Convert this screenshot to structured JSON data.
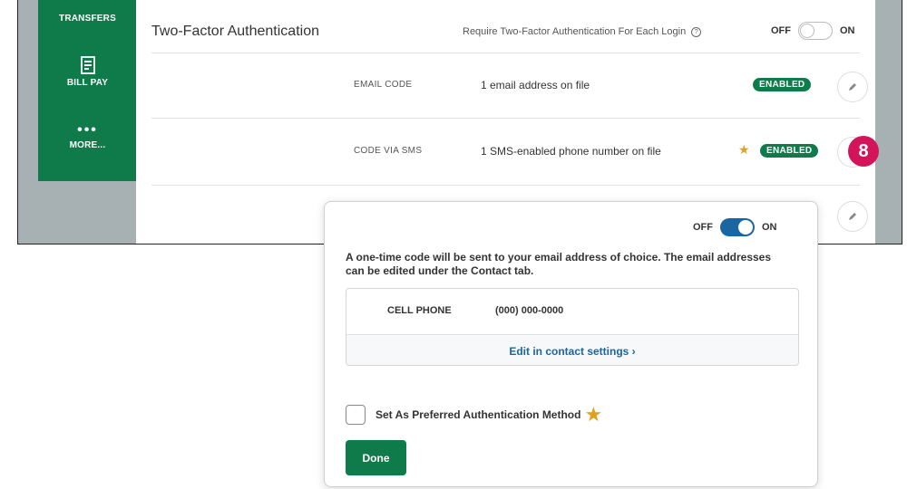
{
  "sidebar": {
    "items": [
      {
        "label": "TRANSFERS",
        "icon": "transfer-icon"
      },
      {
        "label": "BILL PAY",
        "icon": "bill-pay-icon"
      },
      {
        "label": "MORE...",
        "icon": "more-dots-icon",
        "glyph": "•••"
      }
    ]
  },
  "section": {
    "title": "Two-Factor Authentication",
    "requirement_text": "Require Two-Factor Authentication For Each Login",
    "toggle": {
      "off_label": "OFF",
      "on_label": "ON",
      "state": "off"
    }
  },
  "methods": [
    {
      "name": "EMAIL CODE",
      "description": "1 email address on file",
      "status": "ENABLED",
      "preferred": false
    },
    {
      "name": "CODE VIA SMS",
      "description": "1 SMS-enabled phone number on file",
      "status": "ENABLED",
      "preferred": true,
      "star": "★"
    }
  ],
  "step_badge": "8",
  "modal": {
    "toggle": {
      "off_label": "OFF",
      "on_label": "ON",
      "state": "on"
    },
    "description": "A one-time code will be sent to your email address of choice. The email addresses can be edited under the Contact tab.",
    "contact": {
      "label": "CELL PHONE",
      "value": "(000) 000-0000"
    },
    "edit_link": "Edit in contact settings ›",
    "preferred_checkbox": {
      "label": "Set As Preferred Authentication Method",
      "checked": false,
      "star": "★"
    },
    "done_label": "Done"
  },
  "colors": {
    "brand_green": "#0f7a4a",
    "toggle_blue": "#1a66a1",
    "step_badge": "#d4145a",
    "star": "#e0a020"
  }
}
